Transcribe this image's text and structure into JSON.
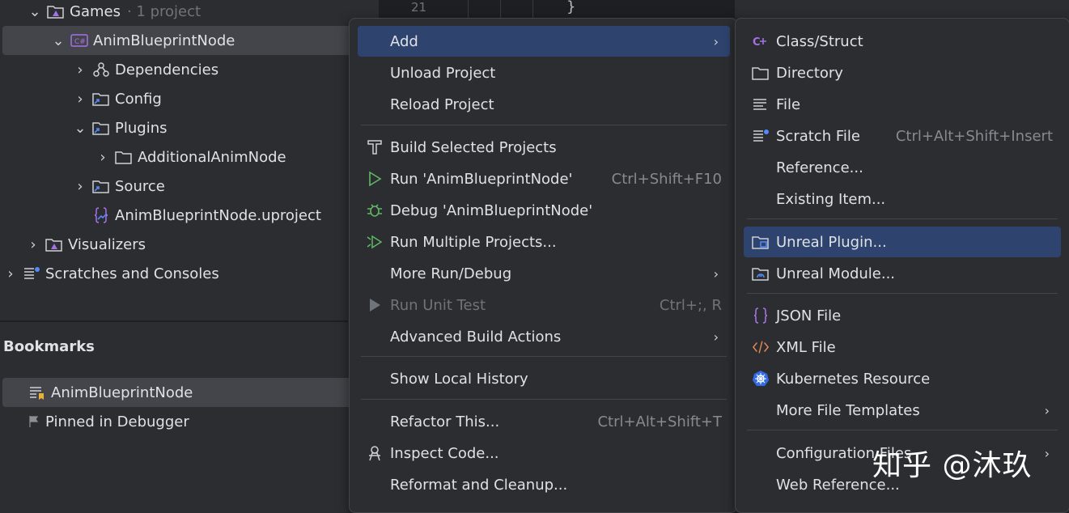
{
  "tree": {
    "games": {
      "label": "Games",
      "meta": "· 1 project"
    },
    "project": {
      "label": "AnimBlueprintNode"
    },
    "dependencies": {
      "label": "Dependencies"
    },
    "config": {
      "label": "Config"
    },
    "plugins": {
      "label": "Plugins"
    },
    "additional": {
      "label": "AdditionalAnimNode"
    },
    "source": {
      "label": "Source"
    },
    "uproject": {
      "label": "AnimBlueprintNode.uproject"
    },
    "visualizers": {
      "label": "Visualizers"
    },
    "scratches": {
      "label": "Scratches and Consoles"
    }
  },
  "bookmarks": {
    "title": "Bookmarks",
    "items": [
      {
        "label": "AnimBlueprintNode"
      },
      {
        "label": "Pinned in Debugger"
      }
    ]
  },
  "editor": {
    "line_number": "21",
    "code": "}"
  },
  "context_menu": {
    "items": [
      {
        "label": "Add"
      },
      {
        "label": "Unload Project"
      },
      {
        "label": "Reload Project"
      },
      {
        "label": "Build Selected Projects"
      },
      {
        "label": "Run 'AnimBlueprintNode'",
        "shortcut": "Ctrl+Shift+F10"
      },
      {
        "label": "Debug 'AnimBlueprintNode'"
      },
      {
        "label": "Run Multiple Projects..."
      },
      {
        "label": "More Run/Debug"
      },
      {
        "label": "Run Unit Test",
        "shortcut": "Ctrl+;, R"
      },
      {
        "label": "Advanced Build Actions"
      },
      {
        "label": "Show Local History"
      },
      {
        "label": "Refactor This...",
        "shortcut": "Ctrl+Alt+Shift+T"
      },
      {
        "label": "Inspect Code..."
      },
      {
        "label": "Reformat and Cleanup..."
      }
    ]
  },
  "add_menu": {
    "items": [
      {
        "label": "Class/Struct"
      },
      {
        "label": "Directory"
      },
      {
        "label": "File"
      },
      {
        "label": "Scratch File",
        "shortcut": "Ctrl+Alt+Shift+Insert"
      },
      {
        "label": "Reference..."
      },
      {
        "label": "Existing Item..."
      },
      {
        "label": "Unreal Plugin..."
      },
      {
        "label": "Unreal Module..."
      },
      {
        "label": "JSON File"
      },
      {
        "label": "XML File"
      },
      {
        "label": "Kubernetes Resource"
      },
      {
        "label": "More File Templates"
      },
      {
        "label": "Configuration Files"
      },
      {
        "label": "Web Reference..."
      }
    ]
  },
  "watermark": "知乎 @沐玖"
}
